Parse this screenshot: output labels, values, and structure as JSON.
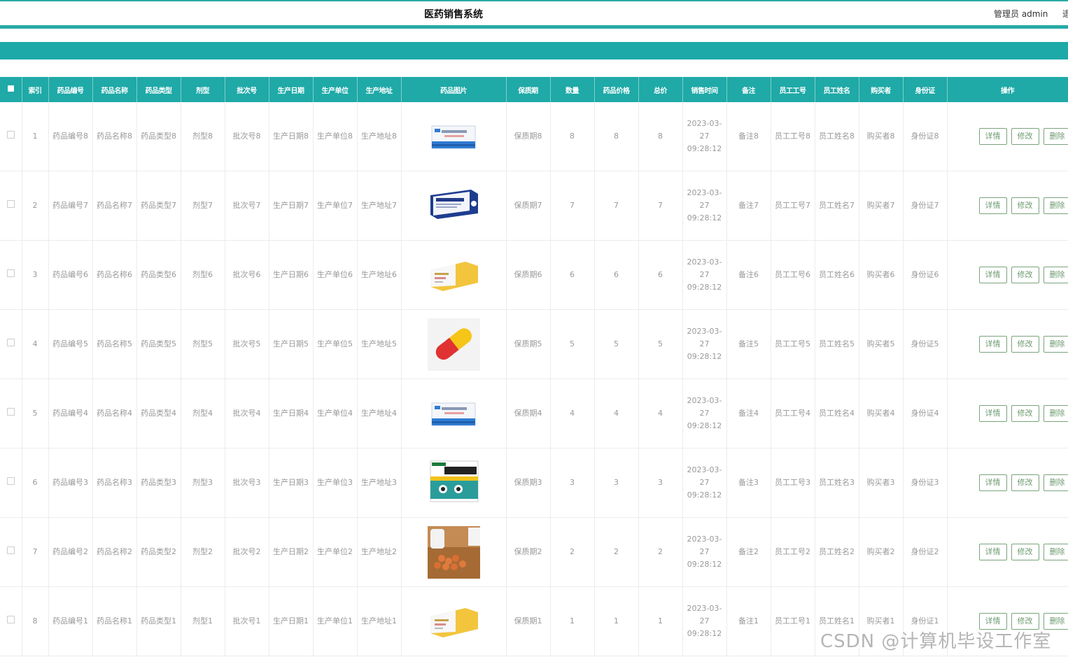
{
  "app": {
    "title": "医药销售系统",
    "user_label": "管理员 admin",
    "logout_label": "退"
  },
  "table": {
    "headers": [
      "索引",
      "药品编号",
      "药品名称",
      "药品类型",
      "剂型",
      "批次号",
      "生产日期",
      "生产单位",
      "生产地址",
      "药品图片",
      "保质期",
      "数量",
      "药品价格",
      "总价",
      "销售时间",
      "备注",
      "员工工号",
      "员工姓名",
      "购买者",
      "身份证",
      "操作"
    ],
    "actions": {
      "detail": "详情",
      "edit": "修改",
      "delete": "删除"
    },
    "rows": [
      {
        "index": "1",
        "code": "药品编号8",
        "name": "药品名称8",
        "type": "药品类型8",
        "form": "剂型8",
        "batch": "批次号8",
        "prod_date": "生产日期8",
        "prod_unit": "生产单位8",
        "prod_addr": "生产地址8",
        "image": "medicine-box-blue-icon",
        "shelf": "保质期8",
        "qty": "8",
        "price": "8",
        "total": "8",
        "time": "2023-03-27 09:28:12",
        "note": "备注8",
        "emp_no": "员工工号8",
        "emp_name": "员工姓名8",
        "buyer": "购买者8",
        "id_card": "身份证8"
      },
      {
        "index": "2",
        "code": "药品编号7",
        "name": "药品名称7",
        "type": "药品类型7",
        "form": "剂型7",
        "batch": "批次号7",
        "prod_date": "生产日期7",
        "prod_unit": "生产单位7",
        "prod_addr": "生产地址7",
        "image": "medicine-box-navy-icon",
        "shelf": "保质期7",
        "qty": "7",
        "price": "7",
        "total": "7",
        "time": "2023-03-27 09:28:12",
        "note": "备注7",
        "emp_no": "员工工号7",
        "emp_name": "员工姓名7",
        "buyer": "购买者7",
        "id_card": "身份证7"
      },
      {
        "index": "3",
        "code": "药品编号6",
        "name": "药品名称6",
        "type": "药品类型6",
        "form": "剂型6",
        "batch": "批次号6",
        "prod_date": "生产日期6",
        "prod_unit": "生产单位6",
        "prod_addr": "生产地址6",
        "image": "medicine-box-yellow-icon",
        "shelf": "保质期6",
        "qty": "6",
        "price": "6",
        "total": "6",
        "time": "2023-03-27 09:28:12",
        "note": "备注6",
        "emp_no": "员工工号6",
        "emp_name": "员工姓名6",
        "buyer": "购买者6",
        "id_card": "身份证6"
      },
      {
        "index": "4",
        "code": "药品编号5",
        "name": "药品名称5",
        "type": "药品类型5",
        "form": "剂型5",
        "batch": "批次号5",
        "prod_date": "生产日期5",
        "prod_unit": "生产单位5",
        "prod_addr": "生产地址5",
        "image": "capsule-icon",
        "shelf": "保质期5",
        "qty": "5",
        "price": "5",
        "total": "5",
        "time": "2023-03-27 09:28:12",
        "note": "备注5",
        "emp_no": "员工工号5",
        "emp_name": "员工姓名5",
        "buyer": "购买者5",
        "id_card": "身份证5"
      },
      {
        "index": "5",
        "code": "药品编号4",
        "name": "药品名称4",
        "type": "药品类型4",
        "form": "剂型4",
        "batch": "批次号4",
        "prod_date": "生产日期4",
        "prod_unit": "生产单位4",
        "prod_addr": "生产地址4",
        "image": "medicine-box-blue-icon",
        "shelf": "保质期4",
        "qty": "4",
        "price": "4",
        "total": "4",
        "time": "2023-03-27 09:28:12",
        "note": "备注4",
        "emp_no": "员工工号4",
        "emp_name": "员工姓名4",
        "buyer": "购买者4",
        "id_card": "身份证4"
      },
      {
        "index": "6",
        "code": "药品编号3",
        "name": "药品名称3",
        "type": "药品类型3",
        "form": "剂型3",
        "batch": "批次号3",
        "prod_date": "生产日期3",
        "prod_unit": "生产单位3",
        "prod_addr": "生产地址3",
        "image": "cough-medicine-box-icon",
        "shelf": "保质期3",
        "qty": "3",
        "price": "3",
        "total": "3",
        "time": "2023-03-27 09:28:12",
        "note": "备注3",
        "emp_no": "员工工号3",
        "emp_name": "员工姓名3",
        "buyer": "购买者3",
        "id_card": "身份证3"
      },
      {
        "index": "7",
        "code": "药品编号2",
        "name": "药品名称2",
        "type": "药品类型2",
        "form": "剂型2",
        "batch": "批次号2",
        "prod_date": "生产日期2",
        "prod_unit": "生产单位2",
        "prod_addr": "生产地址2",
        "image": "pills-bottle-icon",
        "shelf": "保质期2",
        "qty": "2",
        "price": "2",
        "total": "2",
        "time": "2023-03-27 09:28:12",
        "note": "备注2",
        "emp_no": "员工工号2",
        "emp_name": "员工姓名2",
        "buyer": "购买者2",
        "id_card": "身份证2"
      },
      {
        "index": "8",
        "code": "药品编号1",
        "name": "药品名称1",
        "type": "药品类型1",
        "form": "剂型1",
        "batch": "批次号1",
        "prod_date": "生产日期1",
        "prod_unit": "生产单位1",
        "prod_addr": "生产地址1",
        "image": "medicine-box-yellow-icon",
        "shelf": "保质期1",
        "qty": "1",
        "price": "1",
        "total": "1",
        "time": "2023-03-27 09:28:12",
        "note": "备注1",
        "emp_no": "员工工号1",
        "emp_name": "员工姓名1",
        "buyer": "购买者1",
        "id_card": "身份证1"
      }
    ]
  },
  "watermark": "CSDN @计算机毕设工作室"
}
